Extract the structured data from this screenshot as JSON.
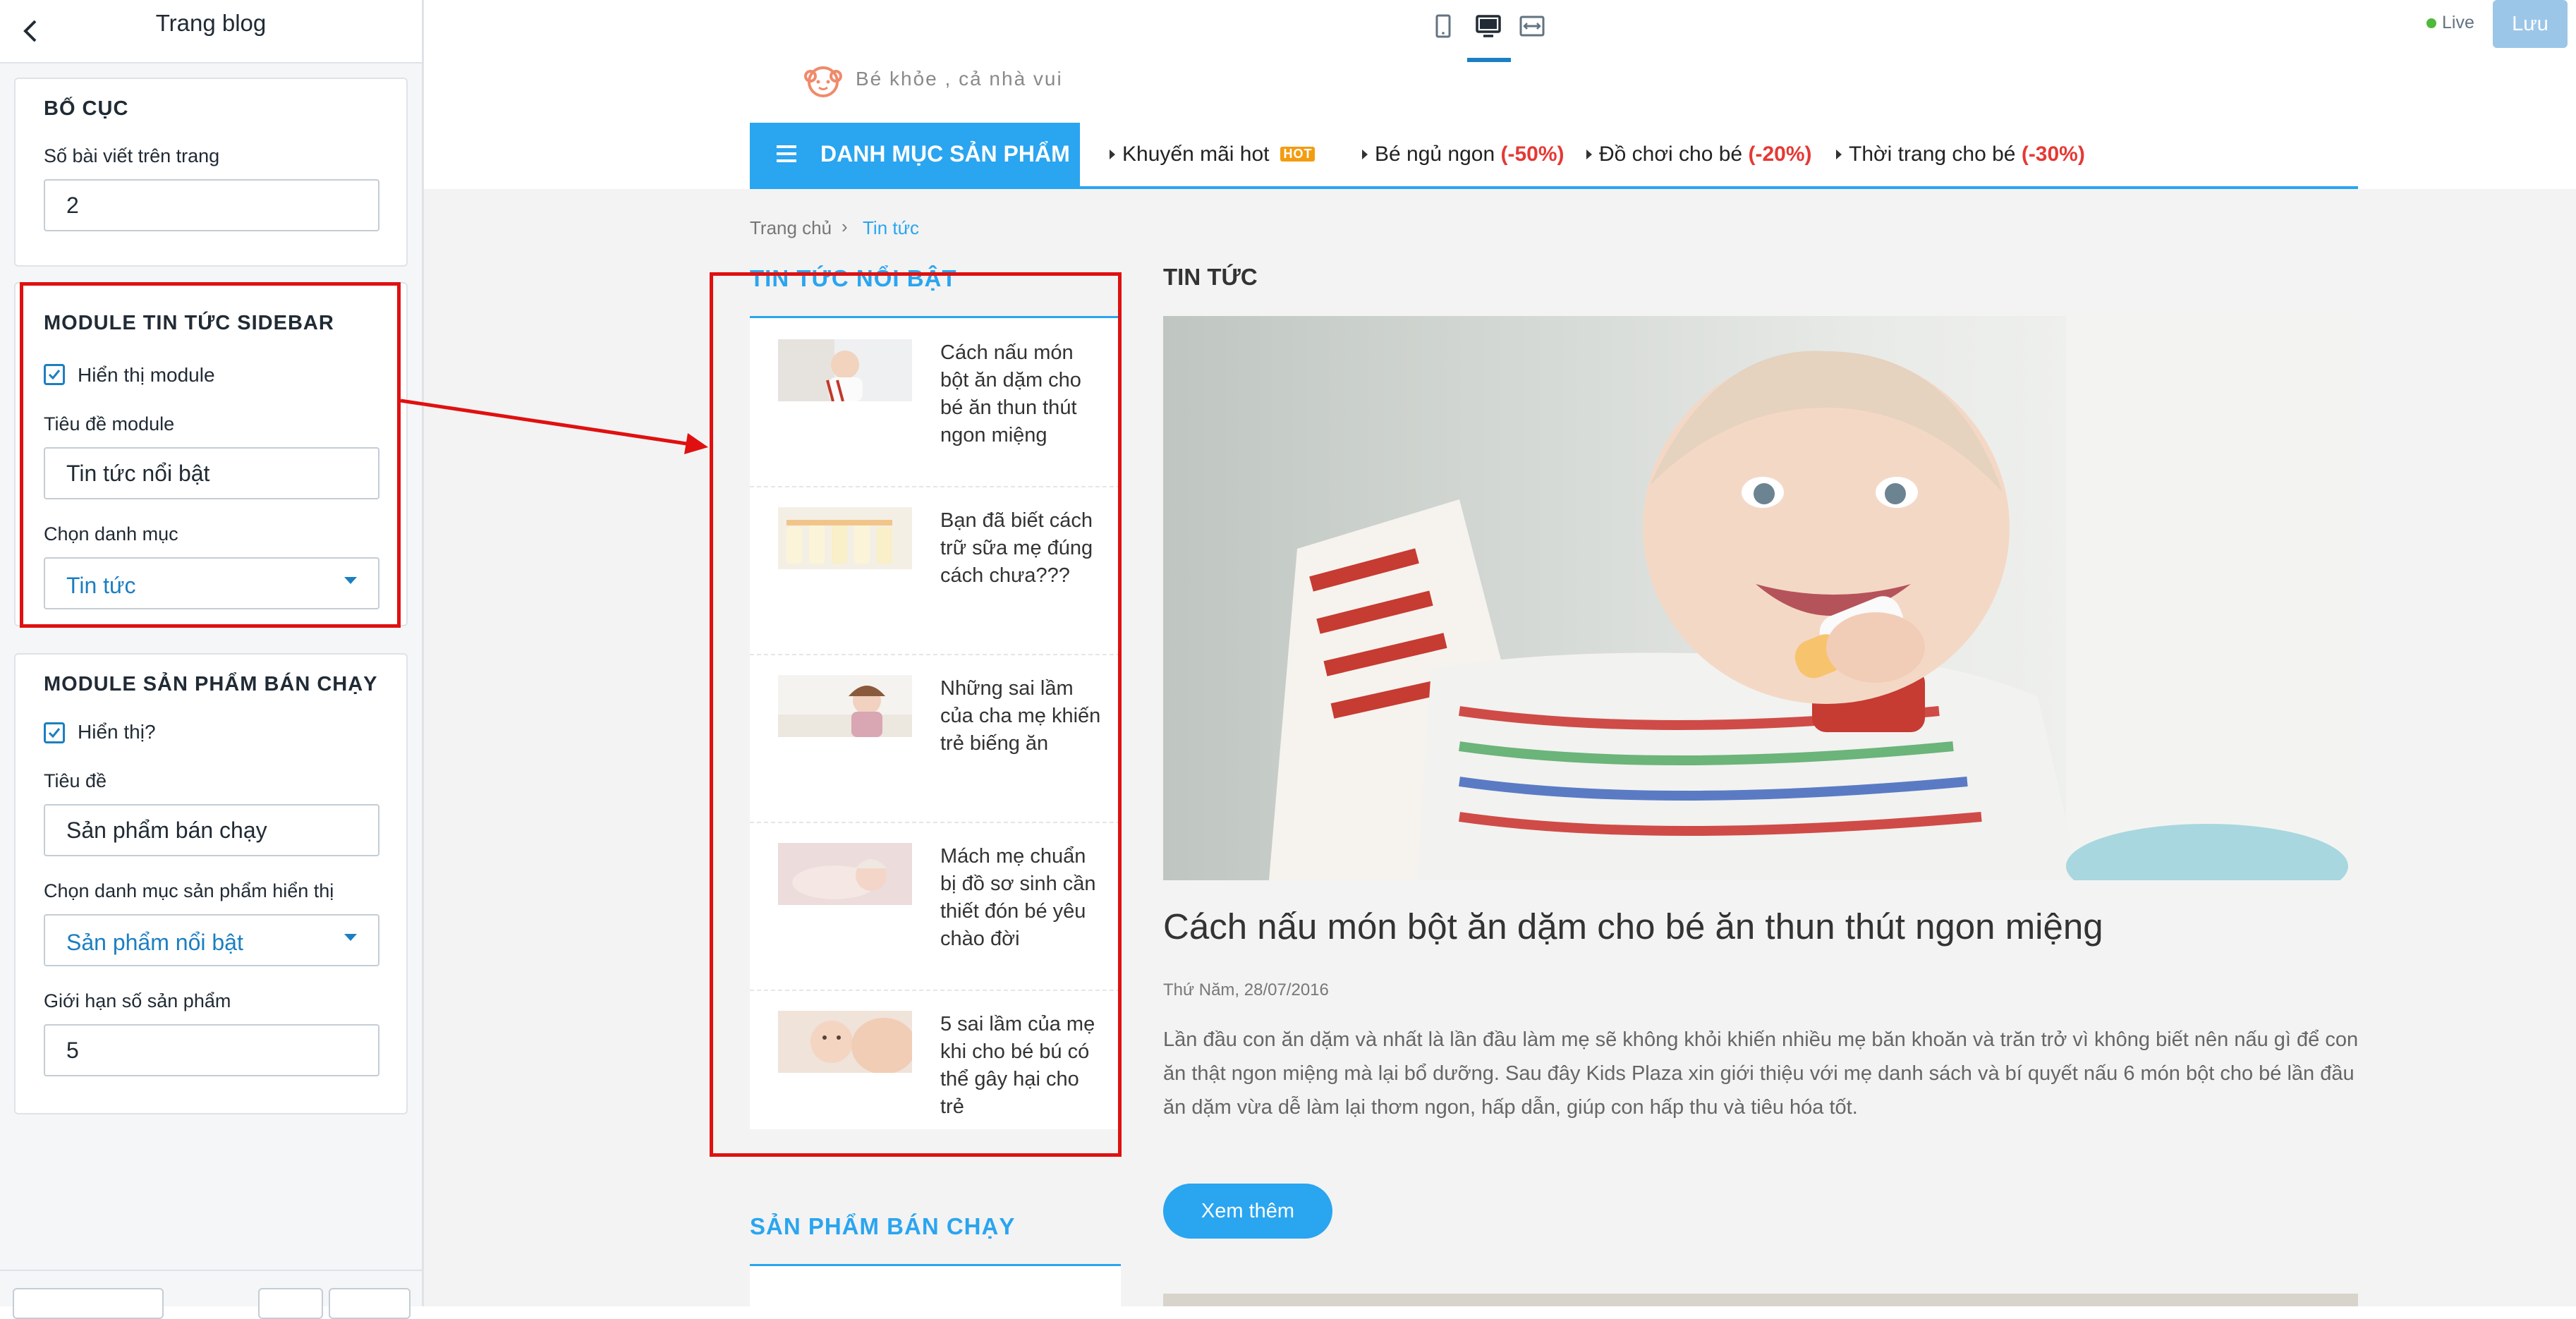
{
  "sidebar": {
    "title": "Trang blog",
    "layout_card": {
      "title": "BỐ CỤC",
      "posts_per_page_label": "Số bài viết trên trang",
      "posts_per_page_value": "2"
    },
    "news_module_card": {
      "title": "MODULE TIN TỨC SIDEBAR",
      "show_label": "Hiển thị module",
      "show_checked": true,
      "module_title_label": "Tiêu đề module",
      "module_title_value": "Tin tức nổi bật",
      "category_label": "Chọn danh mục",
      "category_value": "Tin tức"
    },
    "bestseller_card": {
      "title": "MODULE SẢN PHẨM BÁN CHẠY",
      "show_label": "Hiển thị?",
      "show_checked": true,
      "title_label": "Tiêu đề",
      "title_value": "Sản phẩm bán chạy",
      "category_label": "Chọn danh mục sản phẩm hiển thị",
      "category_value": "Sản phẩm nổi bật",
      "limit_label": "Giới hạn số sản phẩm",
      "limit_value": "5"
    }
  },
  "toolbar": {
    "devices": [
      "mobile-icon",
      "desktop-icon",
      "fullwidth-icon"
    ],
    "active_device": "desktop-icon",
    "live_label": "Live",
    "save_label": "Lưu",
    "accent": "#1b7fc2"
  },
  "preview": {
    "logo_text": "Bé khỏe , cả nhà vui",
    "category_button": "DANH MỤC SẢN PHẨM",
    "nav_items": [
      {
        "label": "Khuyến mãi hot",
        "discount": "",
        "badge": "HOT"
      },
      {
        "label": "Bé ngủ ngon",
        "discount": "(-50%)",
        "badge": ""
      },
      {
        "label": "Đồ chơi cho bé",
        "discount": "(-20%)",
        "badge": ""
      },
      {
        "label": "Thời trang cho bé",
        "discount": "(-30%)",
        "badge": ""
      }
    ],
    "breadcrumb": {
      "home": "Trang chủ",
      "separator": "›",
      "current": "Tin tức"
    },
    "side_news": {
      "title": "TIN TỨC NỔI BẬT",
      "items": [
        {
          "title": "Cách nấu món bột ăn dặm cho bé ăn thun thút ngon miệng"
        },
        {
          "title": "Bạn đã biết cách trữ sữa mẹ đúng cách chưa???"
        },
        {
          "title": "Những sai lầm của cha mẹ khiến trẻ biếng ăn"
        },
        {
          "title": "Mách mẹ chuẩn bị đồ sơ sinh cần thiết đón bé yêu chào đời"
        },
        {
          "title": "5 sai lầm của mẹ khi cho bé bú có thể gây hại cho trẻ"
        }
      ]
    },
    "bestseller_title": "SẢN PHẨM BÁN CHẠY",
    "main": {
      "heading": "TIN TỨC",
      "article_title": "Cách nấu món bột ăn dặm cho bé ăn thun thút ngon miệng",
      "article_date": "Thứ Năm, 28/07/2016",
      "article_excerpt": "Lần đầu con ăn dặm và nhất là lần đầu làm mẹ sẽ không khỏi khiến nhiều mẹ băn khoăn và trăn trở vì không biết nên nấu gì để con ăn thật ngon miệng mà lại bổ dưỡng. Sau đây Kids Plaza xin giới thiệu với mẹ danh sách và bí quyết nấu 6 món bột cho bé lần đầu ăn dặm vừa dễ làm lại thơm ngon, hấp dẫn, giúp con hấp thu và tiêu hóa tốt.",
      "read_more": "Xem thêm"
    },
    "brand_color": "#2aa5f0",
    "discount_color": "#e53935"
  },
  "annotation": {
    "highlight_color": "#e01010"
  }
}
